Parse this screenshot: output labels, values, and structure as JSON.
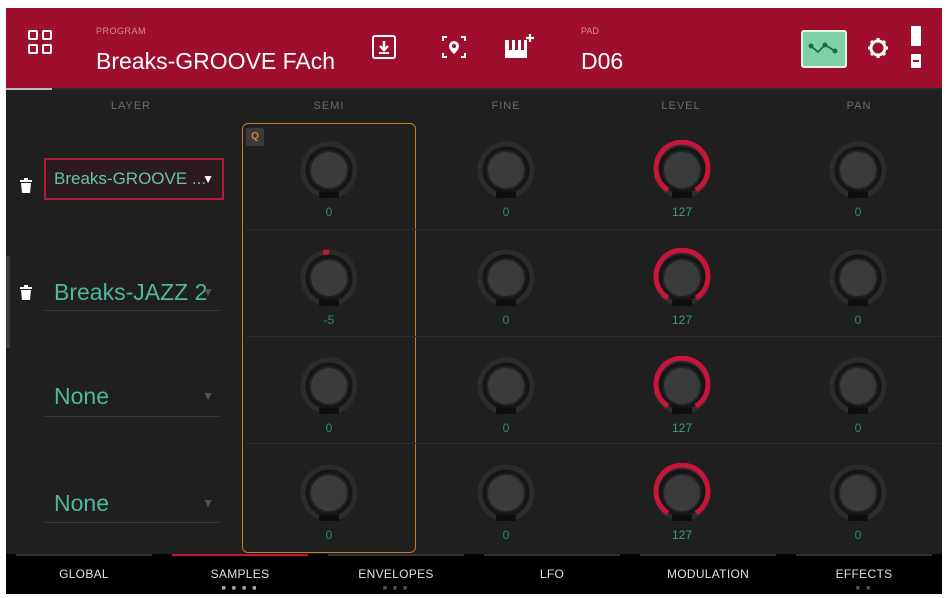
{
  "header": {
    "program_label": "PROGRAM",
    "program_name": "Breaks-GROOVE FAch",
    "pad_label": "PAD",
    "pad_name": "D06",
    "icons": [
      "grid-menu-icon",
      "download-icon",
      "location-icon",
      "piano-add-icon",
      "automation-icon",
      "gear-icon",
      "battery-icon"
    ]
  },
  "columns": [
    "LAYER",
    "SEMI",
    "FINE",
    "LEVEL",
    "PAN"
  ],
  "layers": [
    {
      "sample": "Breaks-GROOVE ...",
      "semi": "0",
      "fine": "0",
      "level": "127",
      "pan": "0",
      "has_trash": true,
      "selected": true
    },
    {
      "sample": "Breaks-JAZZ 2",
      "semi": "-5",
      "fine": "0",
      "level": "127",
      "pan": "0",
      "has_trash": true,
      "selected": false
    },
    {
      "sample": "None",
      "semi": "0",
      "fine": "0",
      "level": "127",
      "pan": "0",
      "has_trash": false,
      "selected": false
    },
    {
      "sample": "None",
      "semi": "0",
      "fine": "0",
      "level": "127",
      "pan": "0",
      "has_trash": false,
      "selected": false
    }
  ],
  "q_badge": "Q",
  "caret": "▼",
  "nav": {
    "items": [
      "GLOBAL",
      "SAMPLES",
      "ENVELOPES",
      "LFO",
      "MODULATION",
      "EFFECTS"
    ],
    "active": "SAMPLES",
    "dots": [
      "",
      "■ ■ ■ ■",
      "■ ■ ■",
      "",
      "",
      "■ ■"
    ]
  },
  "colors": {
    "header": "#9e0f2e",
    "accent_red": "#c8153c",
    "teal_text": "#4fb79a",
    "focus_orange": "#c77b22"
  }
}
